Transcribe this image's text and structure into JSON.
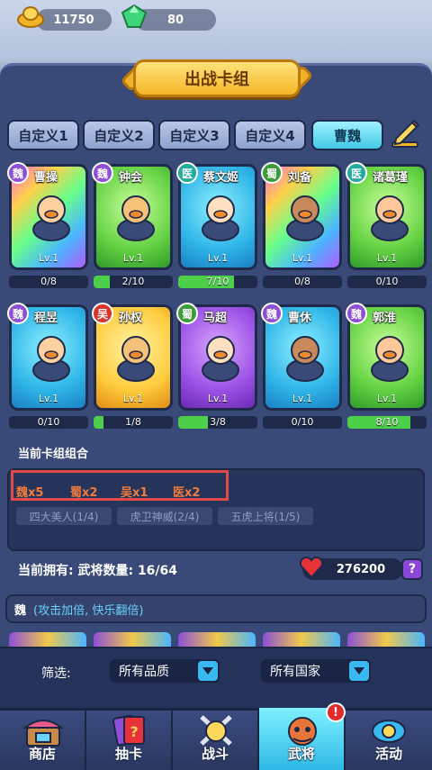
{
  "resources": {
    "gold": "11750",
    "gems": "80"
  },
  "title": "出战卡组",
  "tabs": [
    {
      "label": "自定义1",
      "active": false
    },
    {
      "label": "自定义2",
      "active": false
    },
    {
      "label": "自定义3",
      "active": false
    },
    {
      "label": "自定义4",
      "active": false
    },
    {
      "label": "曹魏",
      "active": true
    }
  ],
  "cards": [
    {
      "faction": "魏",
      "name": "曹操",
      "level": "Lv.1",
      "progress": "0/8",
      "fill": 0,
      "frame": "rainbow"
    },
    {
      "faction": "魏",
      "name": "钟会",
      "level": "Lv.1",
      "progress": "2/10",
      "fill": 0.2,
      "frame": "green"
    },
    {
      "faction": "医",
      "name": "蔡文姬",
      "level": "Lv.1",
      "progress": "7/10",
      "fill": 0.7,
      "frame": "blue"
    },
    {
      "faction": "蜀",
      "name": "刘备",
      "level": "Lv.1",
      "progress": "0/8",
      "fill": 0,
      "frame": "rainbow"
    },
    {
      "faction": "医",
      "name": "诸葛瑾",
      "level": "Lv.1",
      "progress": "0/10",
      "fill": 0,
      "frame": "green"
    },
    {
      "faction": "魏",
      "name": "程昱",
      "level": "Lv.1",
      "progress": "0/10",
      "fill": 0,
      "frame": "blue"
    },
    {
      "faction": "吴",
      "name": "孙权",
      "level": "Lv.1",
      "progress": "1/8",
      "fill": 0.125,
      "frame": "gold"
    },
    {
      "faction": "蜀",
      "name": "马超",
      "level": "Lv.1",
      "progress": "3/8",
      "fill": 0.375,
      "frame": "purple"
    },
    {
      "faction": "魏",
      "name": "曹休",
      "level": "Lv.1",
      "progress": "0/10",
      "fill": 0,
      "frame": "blue"
    },
    {
      "faction": "魏",
      "name": "郭淮",
      "level": "Lv.1",
      "progress": "8/10",
      "fill": 0.8,
      "frame": "green"
    }
  ],
  "combo": {
    "label": "当前卡组组合",
    "factions": [
      "魏x5",
      "蜀x2",
      "吴x1",
      "医x2"
    ],
    "bonds": [
      "四大美人(1/4)",
      "虎卫神威(2/4)",
      "五虎上将(1/5)"
    ]
  },
  "owned": {
    "label": "当前拥有: 武将数量: 16/64",
    "hearts": "276200",
    "help": "?"
  },
  "faction_desc": {
    "faction": "魏",
    "text": "(攻击加倍, 快乐翻倍)"
  },
  "filter": {
    "label": "筛选:",
    "quality": "所有品质",
    "country": "所有国家"
  },
  "nav": [
    {
      "label": "商店",
      "active": false
    },
    {
      "label": "抽卡",
      "active": false
    },
    {
      "label": "战斗",
      "active": false
    },
    {
      "label": "武将",
      "active": true
    },
    {
      "label": "活动",
      "active": false
    }
  ],
  "nav_alert": "!",
  "colors": {
    "wei": "#8c4fd6",
    "shu": "#3d9b3a",
    "wu": "#d9332c",
    "yi": "#22a9a0",
    "accent": "#f5b727"
  }
}
